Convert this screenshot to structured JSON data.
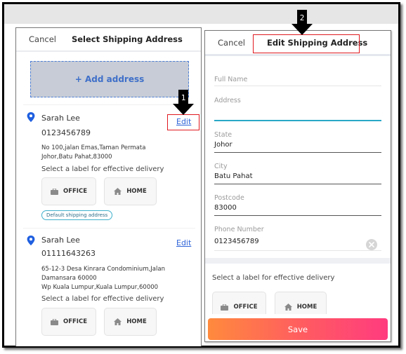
{
  "left_panel": {
    "cancel_label": "Cancel",
    "title": "Select Shipping Address",
    "add_address_label": "+ Add address",
    "addresses": [
      {
        "name": "Sarah Lee",
        "phone": "0123456789",
        "edit_label": "Edit",
        "address_line1": "No 100,jalan Emas,Taman Permata",
        "address_line2": "Johor,Batu Pahat,83000",
        "select_label_prompt": "Select a label for effective delivery",
        "office_label": "OFFICE",
        "home_label": "HOME",
        "badge": "Default shipping address"
      },
      {
        "name": "Sarah Lee",
        "phone": "01111643263",
        "edit_label": "Edit",
        "address_line1": "65-12-3 Desa Kinrara Condominium,Jalan",
        "address_line2": "Damansara 60000",
        "address_line3": "Wp Kuala Lumpur,Kuala Lumpur,60000",
        "select_label_prompt": "Select a label for effective delivery",
        "office_label": "OFFICE",
        "home_label": "HOME"
      }
    ]
  },
  "right_panel": {
    "cancel_label": "Cancel",
    "title": "Edit Shipping Address",
    "fields": {
      "full_name": {
        "label": "Full Name",
        "value": ""
      },
      "address": {
        "label": "Address",
        "value": ""
      },
      "state": {
        "label": "State",
        "value": "Johor"
      },
      "city": {
        "label": "City",
        "value": "Batu Pahat"
      },
      "postcode": {
        "label": "Postcode",
        "value": "83000"
      },
      "phone": {
        "label": "Phone Number",
        "value": "0123456789"
      }
    },
    "select_label_prompt": "Select a label for effective delivery",
    "office_label": "OFFICE",
    "home_label": "HOME",
    "save_label": "Save"
  },
  "annotations": [
    {
      "number": "1",
      "target": "Edit"
    },
    {
      "number": "2",
      "target": "Edit Shipping Address"
    }
  ],
  "colors": {
    "accent_blue": "#2e63d8",
    "active_field": "#29a7c6",
    "save_gradient_start": "#ff8a3d",
    "save_gradient_end": "#ff3b7f",
    "annotation_red": "#e0191f"
  }
}
